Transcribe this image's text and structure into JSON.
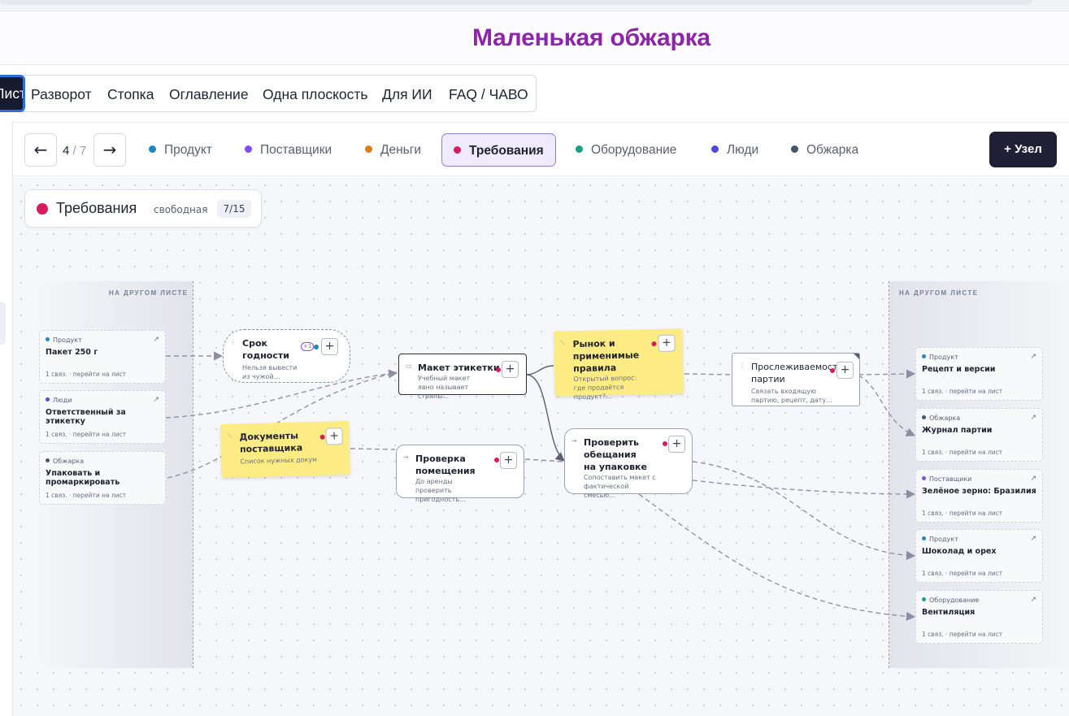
{
  "app": {
    "title": "Маленькая обжарка"
  },
  "modes": [
    {
      "label": "Лист",
      "active": true
    },
    {
      "label": "Разворот"
    },
    {
      "label": "Стопка"
    },
    {
      "label": "Оглавление"
    },
    {
      "label": "Одна плоскость"
    },
    {
      "label": "Для ИИ"
    },
    {
      "label": "FAQ / ЧАВО"
    }
  ],
  "toolbar": {
    "prev": "←",
    "next": "→",
    "page_current": "4",
    "page_sep": " / ",
    "page_total": "7",
    "add_node": "+  Узел",
    "layers": [
      {
        "label": "Продукт",
        "color": "#1e88c7"
      },
      {
        "label": "Поставщики",
        "color": "#7c4dff"
      },
      {
        "label": "Деньги",
        "color": "#e07b16"
      },
      {
        "label": "Требования",
        "color": "#d81b60",
        "active": true
      },
      {
        "label": "Оборудование",
        "color": "#16a085"
      },
      {
        "label": "Люди",
        "color": "#4f46e5"
      },
      {
        "label": "Обжарка",
        "color": "#475569"
      }
    ]
  },
  "sheet": {
    "name": "Требования",
    "mode": "свободная",
    "count": "7/15",
    "color": "#d81b60"
  },
  "canvas": {
    "left_header": "НА ДРУГОМ ЛИСТЕ",
    "right_header": "НА ДРУГОМ ЛИСТЕ",
    "left_external": [
      {
        "cat": "Продукт",
        "color": "#1e88c7",
        "name": "Пакет 250 г",
        "foot": "1 связ. · перейти на лист"
      },
      {
        "cat": "Люди",
        "color": "#4f46e5",
        "name": "Ответственный за этикетку",
        "foot": "1 связ. · перейти на лист"
      },
      {
        "cat": "Обжарка",
        "color": "#475569",
        "name": "Упаковать и промаркировать",
        "foot": "1 связ. · перейти на лист"
      }
    ],
    "right_external": [
      {
        "cat": "Продукт",
        "color": "#1e88c7",
        "name": "Рецепт и версии",
        "foot": "1 связ. · перейти на лист"
      },
      {
        "cat": "Обжарка",
        "color": "#475569",
        "name": "Журнал партии",
        "foot": "1 связ. · перейти на лист"
      },
      {
        "cat": "Поставщики",
        "color": "#7c4dff",
        "name": "Зелёное зерно: Бразилия",
        "foot": "1 связ. · перейти на лист"
      },
      {
        "cat": "Продукт",
        "color": "#1e88c7",
        "name": "Шоколад и орех",
        "foot": "1 связ. · перейти на лист"
      },
      {
        "cat": "Оборудование",
        "color": "#16a085",
        "name": "Вентиляция",
        "foot": "1 связ. · перейти на лист"
      }
    ],
    "nodes": {
      "shelf": {
        "name": "Срок годности",
        "desc": "Нельзя вывести из чужой...",
        "badge": "+1"
      },
      "label": {
        "name": "Макет этикетки",
        "desc": "Учебный макет явно называет страны..."
      },
      "market": {
        "name": "Рынок и применимые правила",
        "desc": "Открытый вопрос: где продаётся продукт?..."
      },
      "trace": {
        "name": "Прослеживаемость партии",
        "desc": "Связать входящую партию, рецепт, дату..."
      },
      "docs": {
        "name": "Документы поставщика",
        "desc": "Список нужных документов должен..."
      },
      "premises": {
        "name": "Проверка помещения",
        "desc": "До аренды проверить пригодность..."
      },
      "promises": {
        "name": "Проверить обещания на упаковке",
        "desc": "Сопоставить макет с фактической смесью..."
      }
    }
  }
}
